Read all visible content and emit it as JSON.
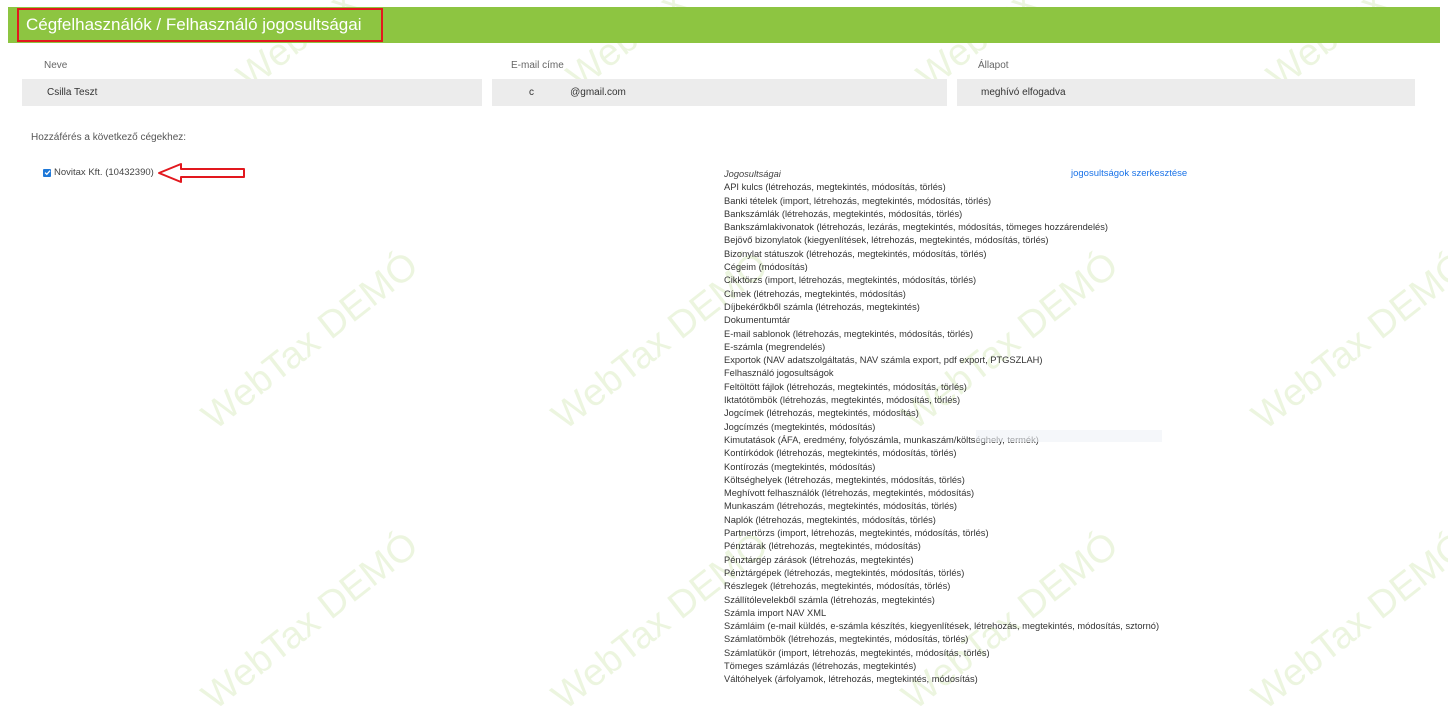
{
  "header": {
    "title": "Cégfelhasználók / Felhasználó jogosultságai"
  },
  "user": {
    "name_label": "Neve",
    "name_value": "Csilla Teszt",
    "email_label": "E-mail címe",
    "email_value": "c             @gmail.com",
    "status_label": "Állapot",
    "status_value": "meghívó elfogadva"
  },
  "access": {
    "heading": "Hozzáférés a következő cégekhez:",
    "companies": [
      {
        "label": "Novitax Kft. (10432390)",
        "checked": true
      }
    ]
  },
  "permissions": {
    "heading": "Jogosultságai",
    "edit_link": "jogosultságok szerkesztése",
    "items": [
      "API kulcs (létrehozás, megtekintés, módosítás, törlés)",
      "Banki tételek (import, létrehozás, megtekintés, módosítás, törlés)",
      "Bankszámlák (létrehozás, megtekintés, módosítás, törlés)",
      "Bankszámlakivonatok (létrehozás, lezárás, megtekintés, módosítás, tömeges hozzárendelés)",
      "Bejövő bizonylatok (kiegyenlítések, létrehozás, megtekintés, módosítás, törlés)",
      "Bizonylat státuszok (létrehozás, megtekintés, módosítás, törlés)",
      "Cégeim (módosítás)",
      "Cikktörzs (import, létrehozás, megtekintés, módosítás, törlés)",
      "Címek (létrehozás, megtekintés, módosítás)",
      "Díjbekérőkből számla (létrehozás, megtekintés)",
      "Dokumentumtár",
      "E-mail sablonok (létrehozás, megtekintés, módosítás, törlés)",
      "E-számla (megrendelés)",
      "Exportok (NAV adatszolgáltatás, NAV számla export, pdf export, PTGSZLAH)",
      "Felhasználó jogosultságok",
      "Feltöltött fájlok (létrehozás, megtekintés, módosítás, törlés)",
      "Iktatótömbök (létrehozás, megtekintés, módosítás, törlés)",
      "Jogcímek (létrehozás, megtekintés, módosítás)",
      "Jogcímzés (megtekintés, módosítás)",
      "Kimutatások (ÁFA, eredmény, folyószámla, munkaszám/költséghely, termék)",
      "Kontírkódok (létrehozás, megtekintés, módosítás, törlés)",
      "Kontírozás (megtekintés, módosítás)",
      "Költséghelyek (létrehozás, megtekintés, módosítás, törlés)",
      "Meghívott felhasználók (létrehozás, megtekintés, módosítás)",
      "Munkaszám (létrehozás, megtekintés, módosítás, törlés)",
      "Naplók (létrehozás, megtekintés, módosítás, törlés)",
      "Partnertörzs (import, létrehozás, megtekintés, módosítás, törlés)",
      "Pénztárak (létrehozás, megtekintés, módosítás)",
      "Pénztárgép zárások (létrehozás, megtekintés)",
      "Pénztárgépek (létrehozás, megtekintés, módosítás, törlés)",
      "Részlegek (létrehozás, megtekintés, módosítás, törlés)",
      "Szállítólevelekből számla (létrehozás, megtekintés)",
      "Számla import NAV XML",
      "Számláim (e-mail küldés, e-számla készítés, kiegyenlítések, létrehozás, megtekintés, módosítás, sztornó)",
      "Számlatömbök (létrehozás, megtekintés, módosítás, törlés)",
      "Számlatükör (import, létrehozás, megtekintés, módosítás, törlés)",
      "Tömeges számlázás (létrehozás, megtekintés)",
      "Váltóhelyek (árfolyamok, létrehozás, megtekintés, módosítás)"
    ]
  },
  "watermark": {
    "text": "WebTax DEMÓ",
    "color": "#8dc541"
  },
  "colors": {
    "header_bg": "#8dc541",
    "highlight_border": "#e2181e",
    "link": "#1a73e8"
  }
}
